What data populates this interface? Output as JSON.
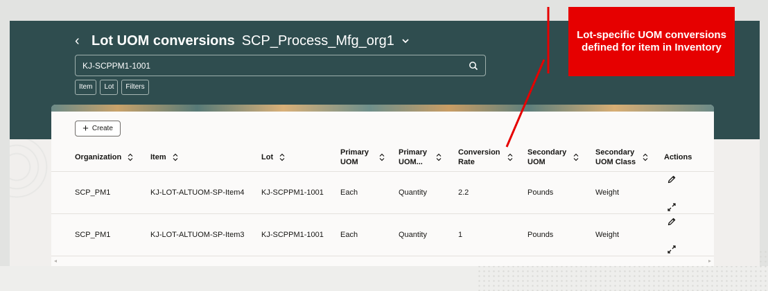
{
  "header": {
    "back_icon": "chevron-left-icon",
    "title": "Lot UOM conversions",
    "org": "SCP_Process_Mfg_org1",
    "org_icon": "chevron-down-icon"
  },
  "search": {
    "value": "KJ-SCPPM1-1001",
    "icon": "search-icon"
  },
  "filter_chips": [
    "Item",
    "Lot",
    "Filters"
  ],
  "toolbar": {
    "create_label": "Create",
    "create_icon": "plus-icon"
  },
  "table": {
    "columns": [
      {
        "line1": "Organization",
        "line2": "",
        "sortable": true
      },
      {
        "line1": "Item",
        "line2": "",
        "sortable": true
      },
      {
        "line1": "Lot",
        "line2": "",
        "sortable": true
      },
      {
        "line1": "Primary",
        "line2": "UOM",
        "sortable": true
      },
      {
        "line1": "Primary",
        "line2": "UOM...",
        "sortable": true
      },
      {
        "line1": "Conversion",
        "line2": "Rate",
        "sortable": true
      },
      {
        "line1": "Secondary",
        "line2": "UOM",
        "sortable": true
      },
      {
        "line1": "Secondary",
        "line2": "UOM Class",
        "sortable": true
      },
      {
        "line1": "Actions",
        "line2": "",
        "sortable": false
      }
    ],
    "rows": [
      {
        "cells": [
          "SCP_PM1",
          "KJ-LOT-ALTUOM-SP-Item4",
          "KJ-SCPPM1-1001",
          "Each",
          "Quantity",
          "2.2",
          "Pounds",
          "Weight"
        ],
        "actions": [
          "edit-icon",
          "expand-icon"
        ]
      },
      {
        "cells": [
          "SCP_PM1",
          "KJ-LOT-ALTUOM-SP-Item3",
          "KJ-SCPPM1-1001",
          "Each",
          "Quantity",
          "1",
          "Pounds",
          "Weight"
        ],
        "actions": [
          "edit-icon",
          "expand-icon"
        ]
      }
    ]
  },
  "callout": {
    "text": "Lot-specific UOM conversions defined for item in Inventory"
  },
  "colors": {
    "header_bg": "#2f4d4f",
    "callout_bg": "#e60000",
    "page_bg": "#f1efed"
  }
}
